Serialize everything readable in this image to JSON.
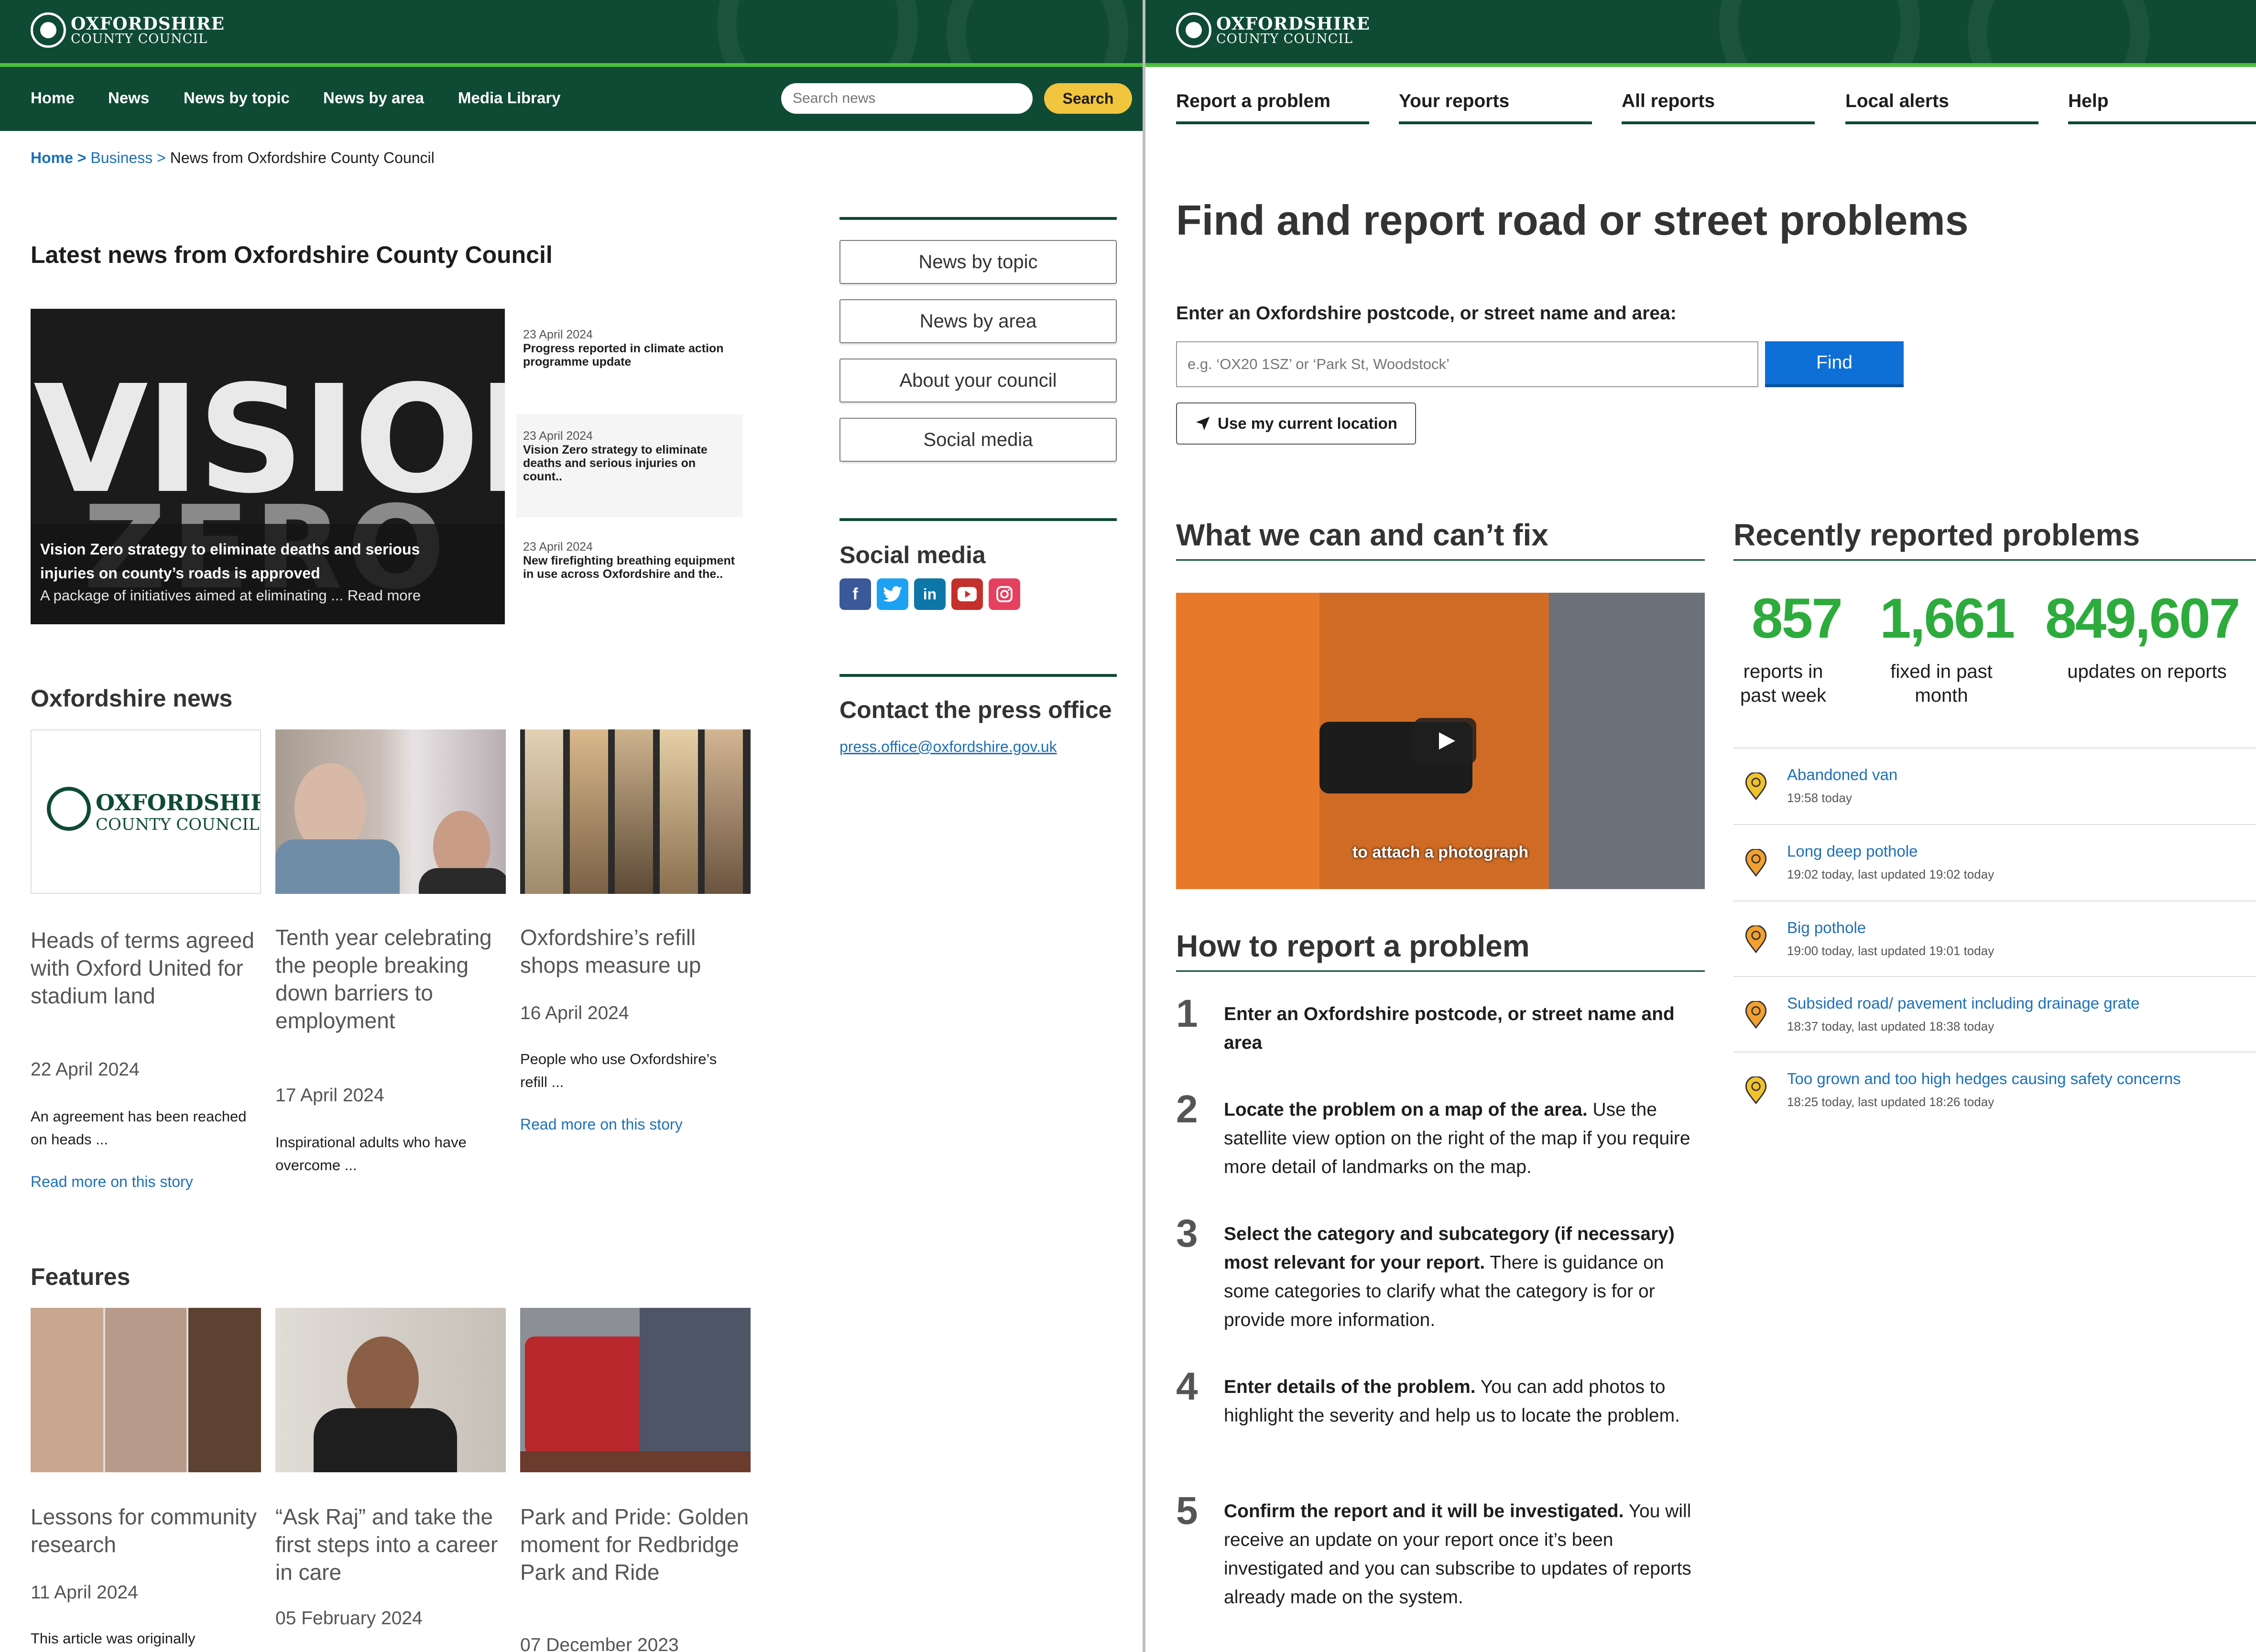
{
  "left": {
    "logo": {
      "line1": "OXFORDSHIRE",
      "line2": "COUNTY COUNCIL"
    },
    "nav": {
      "home": "Home",
      "news": "News",
      "news_by_topic": "News by topic",
      "news_by_area": "News by area",
      "media_library": "Media Library"
    },
    "search": {
      "placeholder": "Search news",
      "button": "Search"
    },
    "breadcrumb": {
      "home": "Home >",
      "business": "Business >",
      "current": "News from Oxfordshire County Council"
    },
    "latest_heading": "Latest news from Oxfordshire County Council",
    "hero": {
      "image_text_1": "VISION",
      "image_text_2": "ZERO",
      "title_line1": "Vision Zero strategy to eliminate deaths and serious",
      "title_line2": "injuries on county’s roads is approved",
      "desc": "A package of initiatives aimed at eliminating ... Read more"
    },
    "side_news": [
      {
        "date": "23 April 2024",
        "title": "Progress reported in climate action programme update"
      },
      {
        "date": "23 April 2024",
        "title": "Vision Zero strategy to eliminate deaths and serious injuries on count.."
      },
      {
        "date": "23 April 2024",
        "title": "New firefighting breathing equipment in use across Oxfordshire and the.."
      }
    ],
    "right_links": [
      "News by topic",
      "News by area",
      "About your council",
      "Social media"
    ],
    "social_heading": "Social media",
    "social_icons": [
      "facebook-icon",
      "twitter-icon",
      "linkedin-icon",
      "youtube-icon",
      "instagram-icon"
    ],
    "press_heading": "Contact the press office",
    "press_email": "press.office@oxfordshire.gov.uk",
    "oxon_news_heading": "Oxfordshire news",
    "news_cards": [
      {
        "title": "Heads of terms agreed with Oxford United for stadium land",
        "date": "22 April 2024",
        "desc": "An agreement has been reached on heads ...",
        "link": "Read more on this story"
      },
      {
        "title": "Tenth year celebrating the people breaking down barriers to employment",
        "date": "17 April 2024",
        "desc": "Inspirational adults who have overcome ..."
      },
      {
        "title": "Oxfordshire’s refill shops measure up",
        "date": "16 April 2024",
        "desc": "People who use Oxfordshire’s refill ...",
        "link": "Read more on this story"
      }
    ],
    "features_heading": "Features",
    "feature_cards": [
      {
        "title": "Lessons for community research",
        "date": "11 April 2024",
        "desc": "This article was originally"
      },
      {
        "title": "“Ask Raj” and take the first steps into a career in care",
        "date": "05 February 2024"
      },
      {
        "title": "Park and Pride: Golden moment for Redbridge Park and Ride",
        "date": "07 December 2023"
      }
    ]
  },
  "right": {
    "logo": {
      "line1": "OXFORDSHIRE",
      "line2": "COUNTY COUNCIL"
    },
    "tabs": [
      "Report a problem",
      "Your reports",
      "All reports",
      "Local alerts",
      "Help"
    ],
    "title": "Find and report road or street problems",
    "postcode_label": "Enter an Oxfordshire postcode, or street name and area:",
    "postcode_placeholder": "e.g. ‘OX20 1SZ’ or ‘Park St, Woodstock’",
    "find_button": "Find",
    "location_button": "Use my current location",
    "fix_heading": "What we can and can’t fix",
    "video_caption": "to attach a photograph",
    "how_heading": "How to report a problem",
    "steps": [
      {
        "num": "1",
        "bold": "Enter an Oxfordshire postcode, or street name and area",
        "rest": ""
      },
      {
        "num": "2",
        "bold": "Locate the problem on a map of the area.",
        "rest": " Use the satellite view option on the right of the map if you require more detail of landmarks on the map."
      },
      {
        "num": "3",
        "bold": "Select the category and subcategory (if necessary) most relevant for your report.",
        "rest": " There is guidance on some categories to clarify what the category is for or provide more information."
      },
      {
        "num": "4",
        "bold": "Enter details of the problem.",
        "rest": " You can add photos to highlight the severity and help us to locate the problem."
      },
      {
        "num": "5",
        "bold": "Confirm the report and it will be investigated.",
        "rest": " You will receive an update on your report once it’s been investigated and you can subscribe to updates of reports already made on the system."
      }
    ],
    "recent_heading": "Recently reported problems",
    "stats": [
      {
        "value": "857",
        "label_1": "reports in",
        "label_2": "past week"
      },
      {
        "value": "1,661",
        "label_1": "fixed in past",
        "label_2": "month"
      },
      {
        "value": "849,607",
        "label_1": "updates on reports",
        "label_2": ""
      }
    ],
    "problems": [
      {
        "title": "Abandoned van",
        "meta": "19:58 today",
        "pin_color": "#f2c12e"
      },
      {
        "title": "Long deep pothole",
        "meta": "19:02 today, last updated 19:02 today",
        "pin_color": "#f2a12e"
      },
      {
        "title": "Big pothole",
        "meta": "19:00 today, last updated 19:01 today",
        "pin_color": "#f2a12e"
      },
      {
        "title": "Subsided road/ pavement including drainage grate",
        "meta": "18:37 today, last updated 18:38 today",
        "pin_color": "#f2a12e"
      },
      {
        "title": "Too grown and too high hedges causing safety concerns",
        "meta": "18:25 today, last updated 18:26 today",
        "pin_color": "#f2c12e"
      }
    ]
  },
  "colors": {
    "brand_green": "#0f4a34",
    "accent_green": "#4bbf3a",
    "link_blue": "#1d70b8",
    "search_yellow": "#f1c53d",
    "stat_green": "#2dab3c",
    "find_blue": "#0e6fd6"
  }
}
